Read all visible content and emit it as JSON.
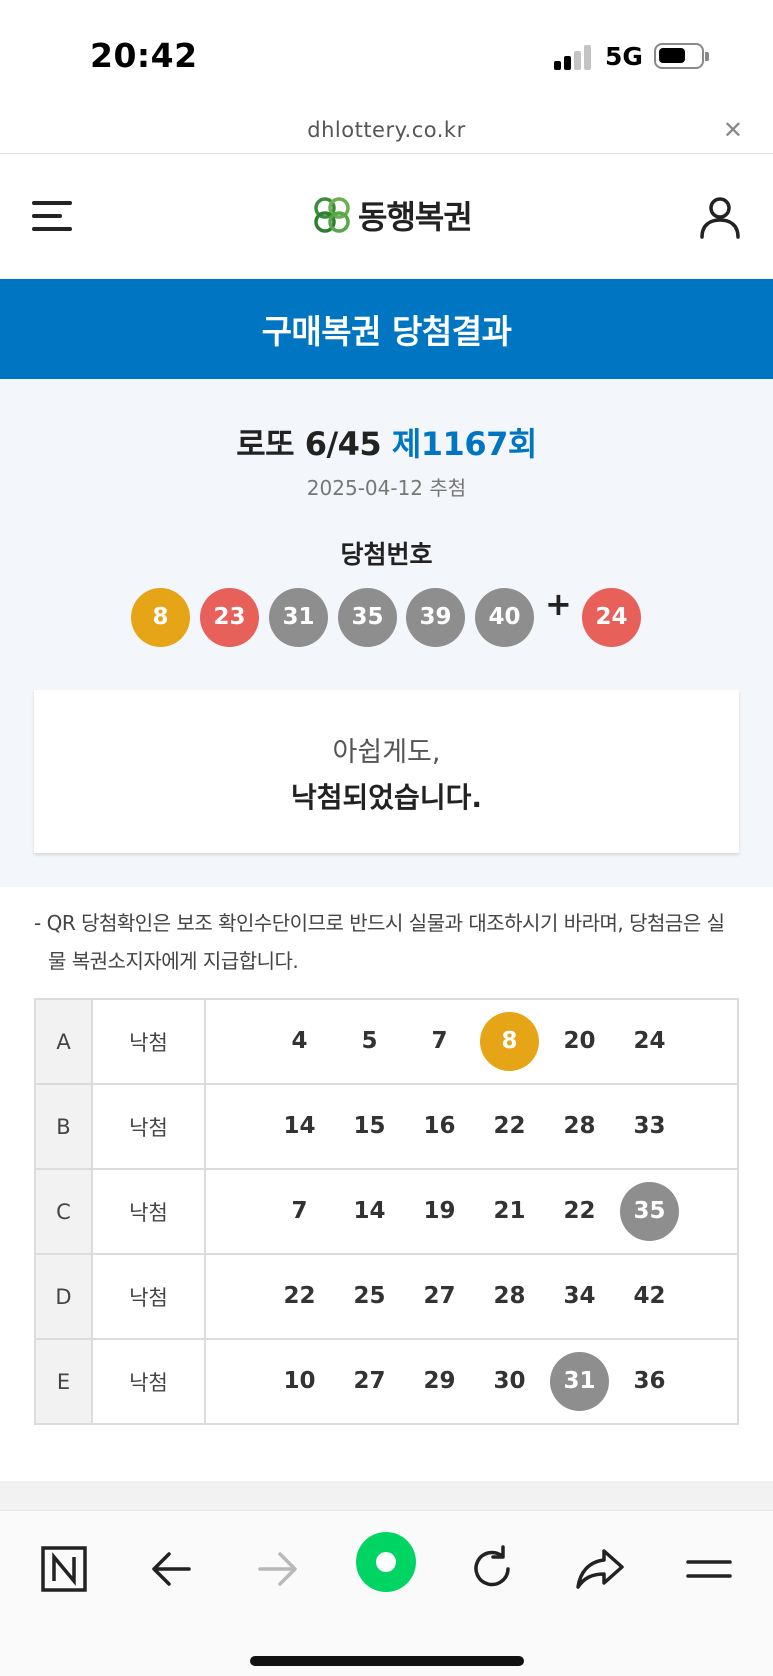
{
  "status_bar": {
    "time": "20:42",
    "network": "5G"
  },
  "browser": {
    "url": "dhlottery.co.kr",
    "close_icon": "close-icon"
  },
  "header": {
    "logo_text": "동행복권",
    "menu_icon": "hamburger-menu-icon",
    "user_icon": "user-icon"
  },
  "banner": {
    "title": "구매복권 당첨결과"
  },
  "draw": {
    "title_prefix": "로또 6/45",
    "round": "제1167회",
    "date": "2025-04-12 추첨",
    "winning_label": "당첨번호",
    "numbers": [
      "8",
      "23",
      "31",
      "35",
      "39",
      "40"
    ],
    "plus": "+",
    "bonus": "24"
  },
  "result": {
    "sub": "아쉽게도,",
    "main": "낙첨되었습니다."
  },
  "notice": "- QR 당첨확인은 보조 확인수단이므로 반드시 실물과 대조하시기 바라며, 당첨금은 실물 복권소지자에게 지급합니다.",
  "tickets": [
    {
      "label": "A",
      "status": "낙첨",
      "numbers": [
        "4",
        "5",
        "7",
        "8",
        "20",
        "24"
      ],
      "matched": [
        "8"
      ]
    },
    {
      "label": "B",
      "status": "낙첨",
      "numbers": [
        "14",
        "15",
        "16",
        "22",
        "28",
        "33"
      ],
      "matched": []
    },
    {
      "label": "C",
      "status": "낙첨",
      "numbers": [
        "7",
        "14",
        "19",
        "21",
        "22",
        "35"
      ],
      "matched": [
        "35"
      ]
    },
    {
      "label": "D",
      "status": "낙첨",
      "numbers": [
        "22",
        "25",
        "27",
        "28",
        "34",
        "42"
      ],
      "matched": []
    },
    {
      "label": "E",
      "status": "낙첨",
      "numbers": [
        "10",
        "27",
        "29",
        "30",
        "31",
        "36"
      ],
      "matched": [
        "31"
      ]
    }
  ],
  "ball_colors": {
    "yellow": "#e6a417",
    "red": "#e8605a",
    "gray": "#8e8e8e",
    "accent_blue": "#0075c2",
    "browser_green": "#00d563"
  },
  "bottom_bar": {
    "items": [
      "naver-icon",
      "back-arrow-icon",
      "forward-arrow-icon",
      "green-home-icon",
      "refresh-icon",
      "share-icon",
      "menu-icon"
    ]
  }
}
